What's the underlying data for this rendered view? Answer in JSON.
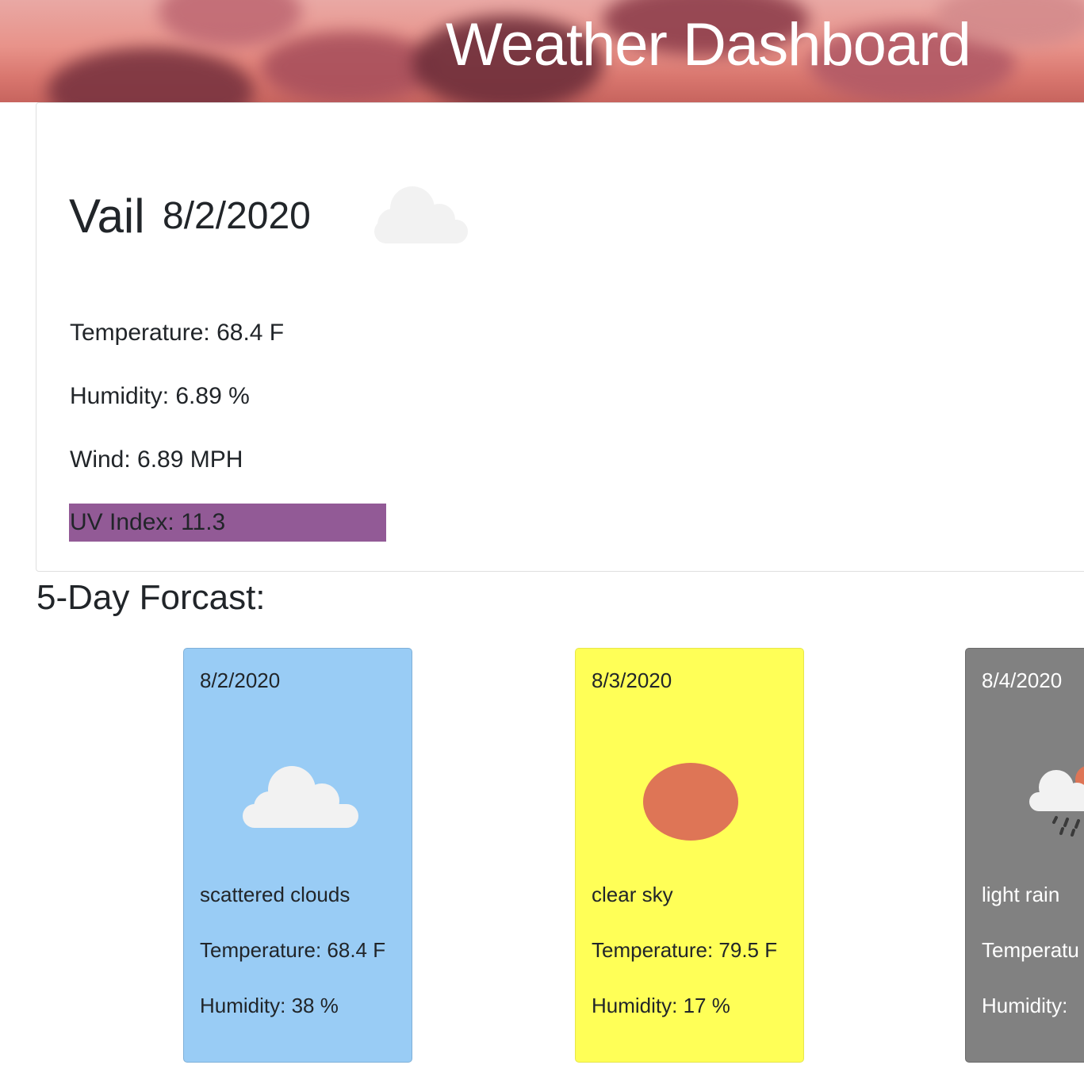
{
  "header": {
    "title": "Weather Dashboard"
  },
  "current": {
    "city": "Vail",
    "date": "8/2/2020",
    "icon": "cloud-icon",
    "temperature": "Temperature: 68.4 F",
    "humidity": "Humidity: 6.89 %",
    "wind": "Wind: 6.89 MPH",
    "uv_index": "UV Index: 11.3",
    "uv_color": "#925a96"
  },
  "forecast": {
    "title": "5-Day Forcast:",
    "days": [
      {
        "date": "8/2/2020",
        "icon": "cloud-icon",
        "description": "scattered clouds",
        "temperature": "Temperature: 68.4 F",
        "humidity": "Humidity: 38 %",
        "bg_color": "#99ccf5",
        "border_color": "#7fb0d8",
        "text_color": "#212529"
      },
      {
        "date": "8/3/2020",
        "icon": "sun-icon",
        "description": "clear sky",
        "temperature": "Temperature: 79.5 F",
        "humidity": "Humidity: 17 %",
        "bg_color": "#ffff57",
        "border_color": "#e6e64a",
        "text_color": "#212529"
      },
      {
        "date": "8/4/2020",
        "icon": "rain-icon",
        "description": "light rain",
        "temperature": "Temperatu",
        "humidity": "Humidity: ",
        "bg_color": "#818181",
        "border_color": "#6b6b6b",
        "text_color": "#ffffff"
      }
    ]
  }
}
